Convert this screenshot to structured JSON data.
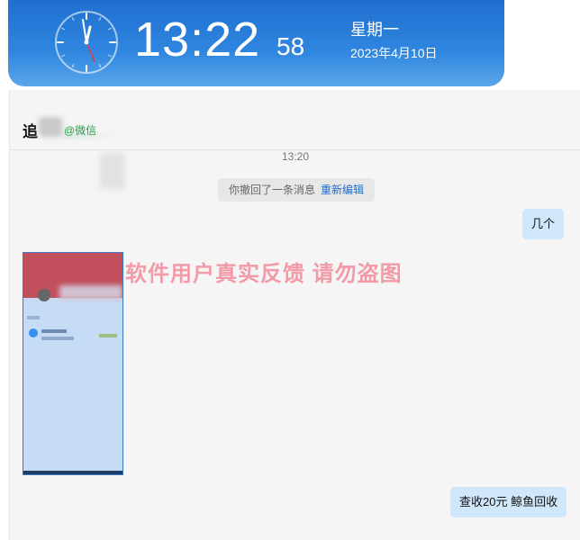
{
  "clock": {
    "time_hm": "13:22",
    "seconds": "58",
    "weekday": "星期一",
    "date": "2023年4月10日"
  },
  "chat": {
    "contact_name": "追",
    "contact_tag": "@微信",
    "timestamp": "13:20",
    "recall_text": "你撤回了一条消息",
    "recall_link": "重新编辑",
    "messages_right": [
      "几个",
      "查收20元 鲸鱼回收"
    ],
    "watermark": "软件用户真实反馈  请勿盗图"
  },
  "colors": {
    "banner_blue": "#2f86df",
    "bubble_blue": "#cfe6fb",
    "link_blue": "#1a6fd1",
    "watermark_pink": "#f29aa7",
    "wechat_green": "#29a34a"
  }
}
